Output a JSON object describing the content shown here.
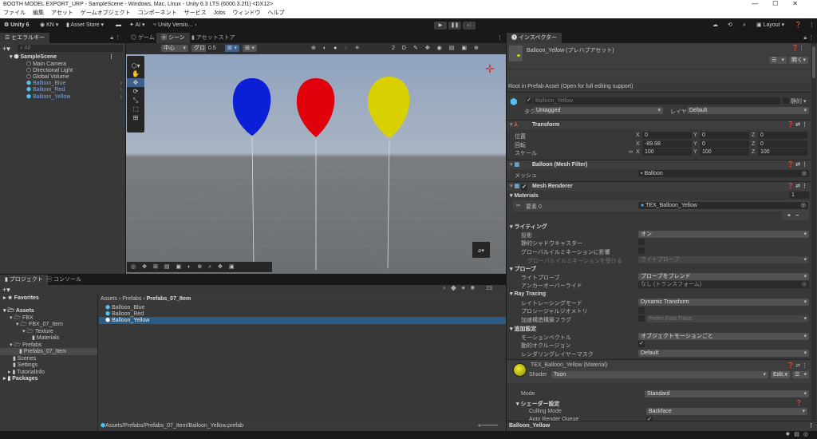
{
  "window": {
    "title": "BOOTH MODEL EXPORT_URP - SampleScene - Windows, Mac, Linux - Unity 6.3 LTS (6000.3.2f1) <DX12>",
    "controls": [
      "—",
      "☐",
      "✕"
    ]
  },
  "menu": [
    "ファイル",
    "編集",
    "アセット",
    "ゲームオブジェクト",
    "コンポーネント",
    "サービス",
    "Jobs",
    "ウィンドウ",
    "ヘルプ"
  ],
  "toolbar": {
    "unity": "Unity 6",
    "account": "KN ▾",
    "asset_store": "Asset Store ▾",
    "ai": "AI ▾",
    "version_control": "Unity Versio... ▾",
    "layout": "Layout ▾"
  },
  "hierarchy": {
    "tab": "ヒエラルキー",
    "search_placeholder": "All",
    "scene": "SampleScene",
    "items": [
      "Main Camera",
      "Directional Light",
      "Global Volume",
      "Balloon_Blue",
      "Balloon_Red",
      "Balloon_Yellow"
    ]
  },
  "scene": {
    "tabs": [
      "ゲーム",
      "シーン",
      "アセットストア"
    ],
    "pivot": "中心",
    "space": "グローバル",
    "snap": "0.5"
  },
  "project": {
    "tabs": [
      "プロジェクト",
      "コンソール"
    ],
    "tree": [
      "Favorites",
      "Assets",
      "FBX",
      "FBX_07_Item",
      "Texture",
      "Materials",
      "Prefabs",
      "Prefabs_07_Item",
      "Scenes",
      "Settings",
      "TutorialInfo",
      "Packages"
    ],
    "breadcrumb": [
      "Assets",
      "Prefabs",
      "Prefabs_07_Item"
    ],
    "items": [
      "Balloon_Blue",
      "Balloon_Red",
      "Balloon_Yellow"
    ],
    "count": "23",
    "path": "Assets/Prefabs/Prefabs_07_Item/Balloon_Yellow.prefab"
  },
  "inspector": {
    "tab": "インスペクター",
    "asset_title": "Balloon_Yellow (プレハブアセット)",
    "open": "開く",
    "root_note": "Root in Prefab Asset (Open for full editing support)",
    "name": "Balloon_Yellow",
    "static": "静的",
    "tag_label": "タグ",
    "tag": "Untagged",
    "layer_label": "レイヤー",
    "layer": "Default",
    "transform": {
      "title": "Transform",
      "position_label": "位置",
      "rotation_label": "回転",
      "scale_label": "スケール",
      "position": [
        "0",
        "0",
        "0"
      ],
      "rotation": [
        "-89.98",
        "0",
        "0"
      ],
      "scale": [
        "100",
        "100",
        "100"
      ]
    },
    "mesh_filter": {
      "title": "Balloon (Mesh Filter)",
      "mesh_label": "メッシュ",
      "mesh": "Balloon"
    },
    "mesh_renderer": {
      "title": "Mesh Renderer",
      "materials": "Materials",
      "materials_count": "1",
      "element_label": "要素 0",
      "element": "TEX_Balloon_Yellow",
      "lighting": "ライティング",
      "cast_shadows_label": "投影",
      "cast_shadows": "オン",
      "static_shadow": "静的シャドウキャスター",
      "contribute_gi": "グローバルイルミネーションに影響",
      "receive_gi_label": "グローバルイルミネーションを受ける",
      "receive_gi": "ライトプローブ",
      "probes": "プローブ",
      "light_probes_label": "ライトプローブ",
      "light_probes": "プローブをブレンド",
      "anchor_label": "アンカーオーバーライド",
      "anchor": "なし (トランスフォーム)",
      "ray_tracing": "Ray Tracing",
      "rt_mode_label": "レイトレーシングモード",
      "rt_mode": "Dynamic Transform",
      "procedural": "プロシージャルジオメトリ",
      "accel_label": "加速構造構築フラグ",
      "accel": "Prefer Fast Trace",
      "additional": "追加設定",
      "motion_label": "モーションベクトル",
      "motion": "オブジェクトモーションごと",
      "dynamic_occlusion": "動的オクルージョン",
      "layer_mask_label": "レンダリングレイヤーマスク",
      "layer_mask": "Default"
    },
    "material": {
      "title": "TEX_Balloon_Yellow (Material)",
      "shader_label": "Shader",
      "shader": "Toon",
      "edit": "Edit...",
      "mode_label": "Mode",
      "mode": "Standard",
      "shader_settings": "シェーダー設定",
      "culling_label": "Culling Mode",
      "culling": "Backface",
      "auto_queue": "Auto Render Queue"
    },
    "footer": "Balloon_Yellow"
  },
  "colors": {
    "blue": "#0a1fd6",
    "red": "#e0000c",
    "yellow": "#d8d000",
    "selection": "#2c5d87"
  }
}
